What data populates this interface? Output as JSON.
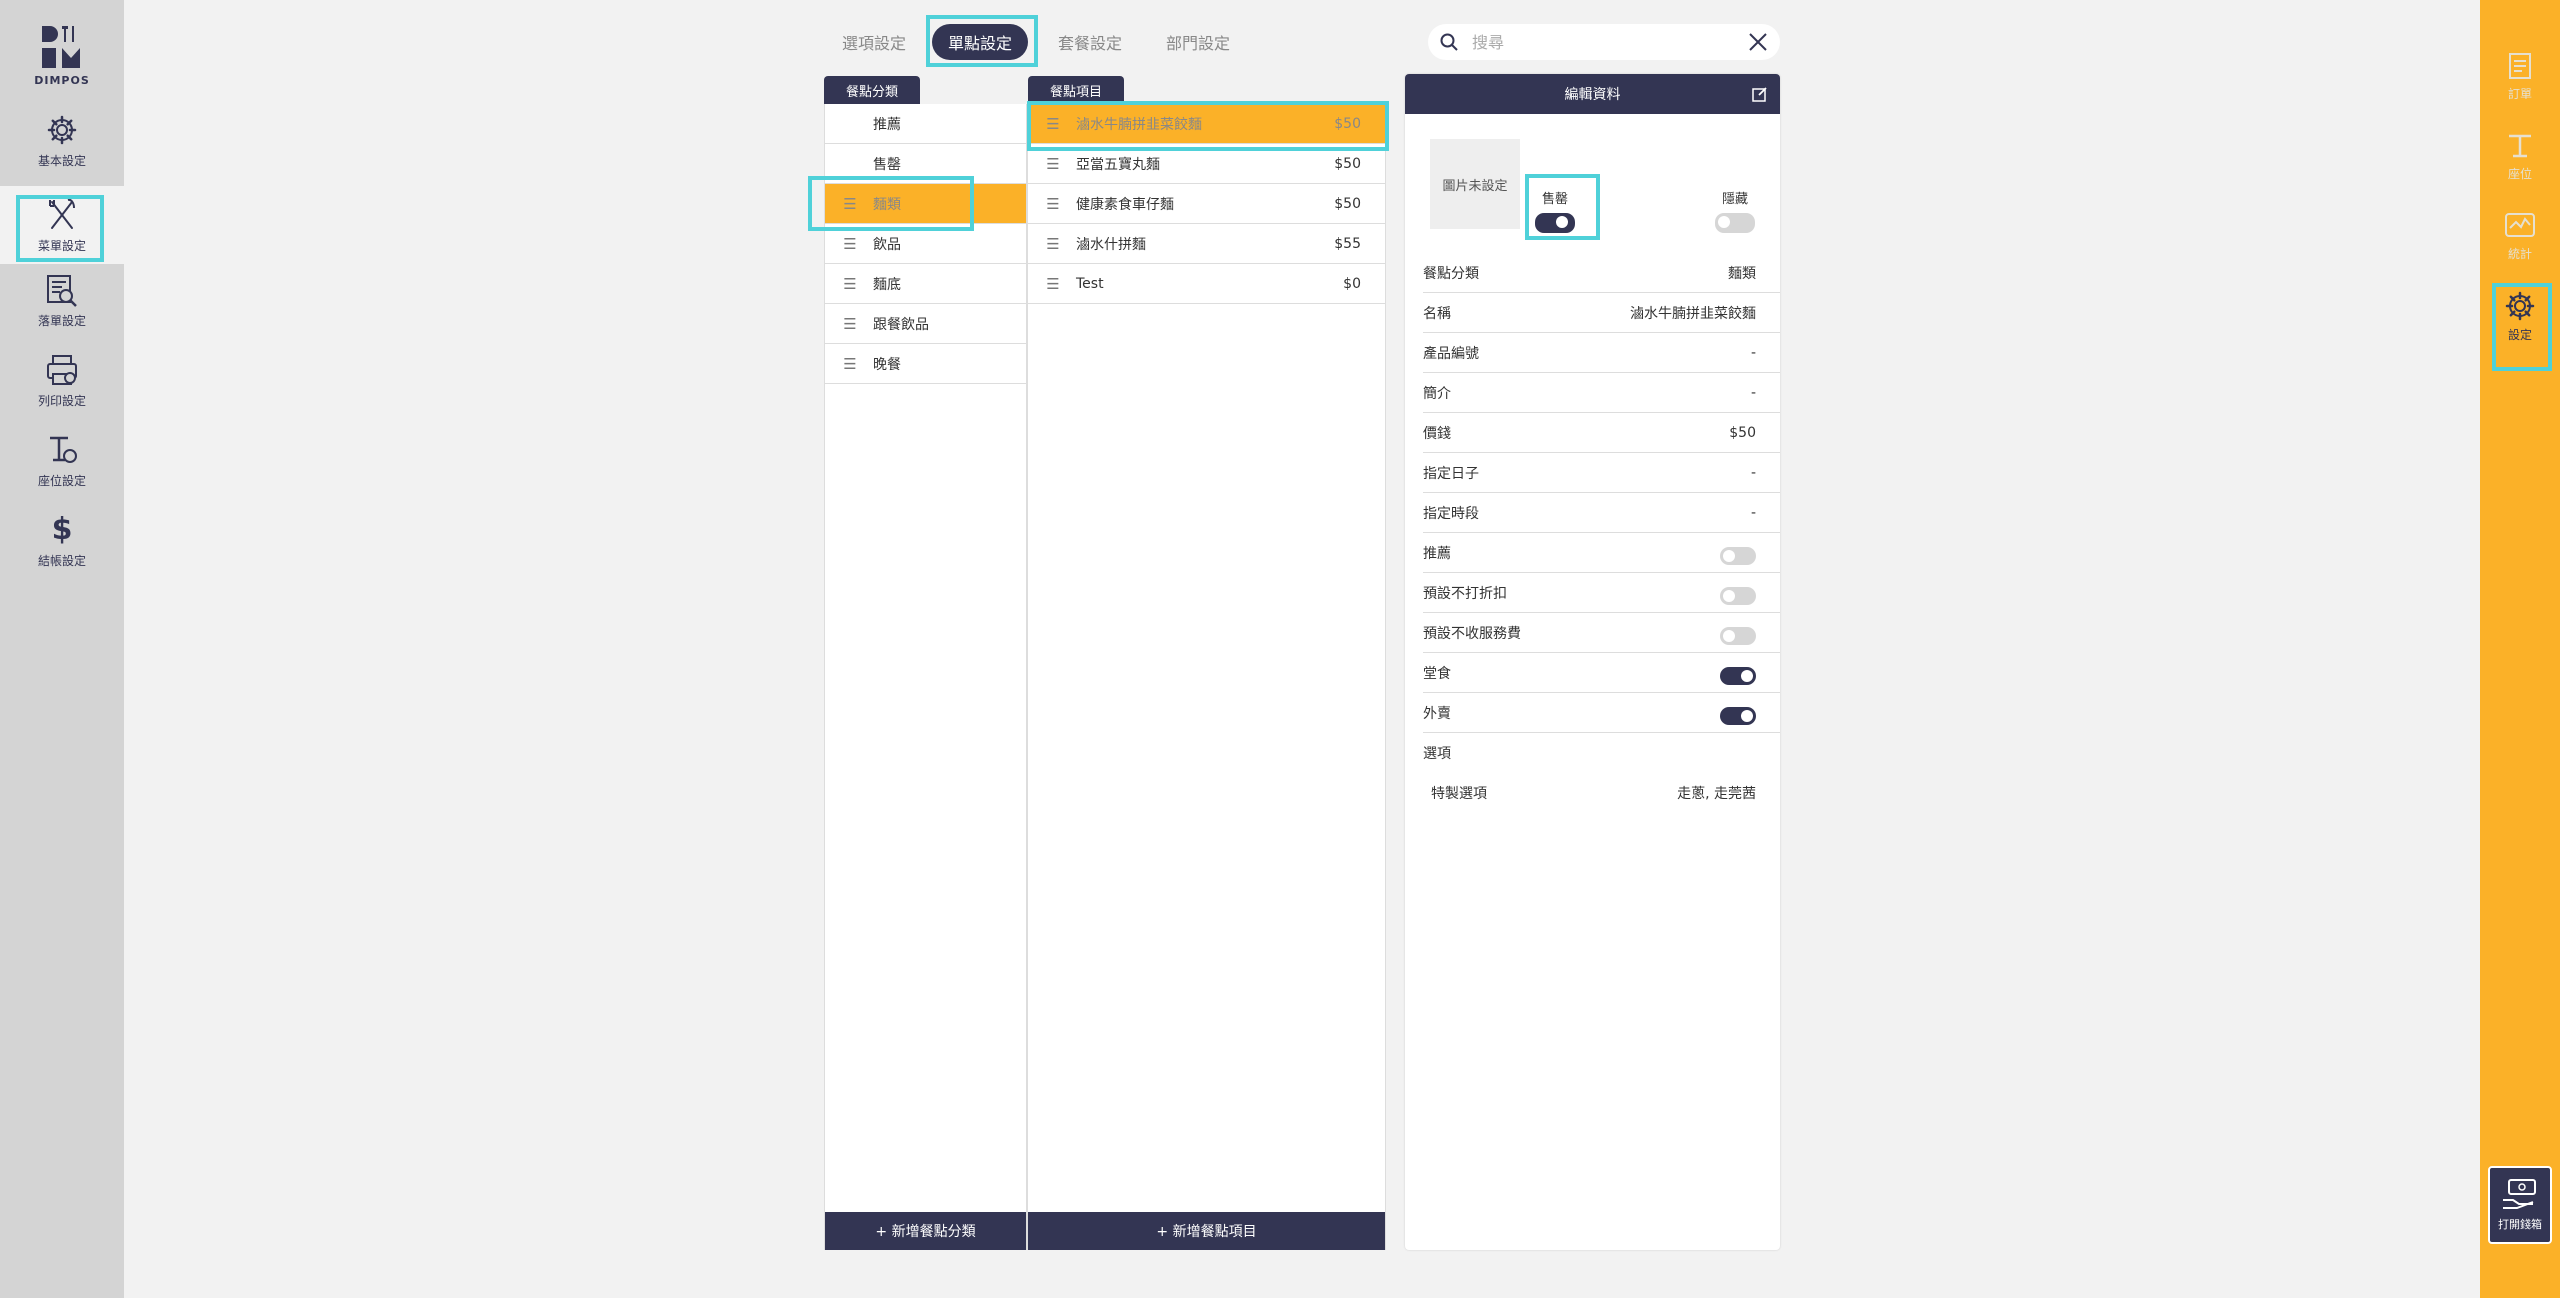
{
  "brand": {
    "logo_text": "DIMPOS"
  },
  "left_nav": [
    {
      "label": "基本設定",
      "icon": "gear-icon"
    },
    {
      "label": "菜單設定",
      "icon": "utensils-icon"
    },
    {
      "label": "落單設定",
      "icon": "order-search-icon"
    },
    {
      "label": "列印設定",
      "icon": "printer-icon"
    },
    {
      "label": "座位設定",
      "icon": "seat-icon"
    },
    {
      "label": "結帳設定",
      "icon": "dollar-icon"
    }
  ],
  "right_nav": [
    {
      "label": "訂單",
      "icon": "order-list-icon"
    },
    {
      "label": "座位",
      "icon": "table-icon"
    },
    {
      "label": "統計",
      "icon": "chart-icon"
    },
    {
      "label": "設定",
      "icon": "gear-icon"
    }
  ],
  "cashbox": {
    "label": "打開錢箱"
  },
  "tabs": [
    "選項設定",
    "單點設定",
    "套餐設定",
    "部門設定"
  ],
  "search": {
    "placeholder": "搜尋"
  },
  "categories": {
    "header": "餐點分類",
    "items": [
      "推薦",
      "售罄",
      "麵類",
      "飲品",
      "麵底",
      "跟餐飲品",
      "晚餐"
    ],
    "footer": "+ 新增餐點分類"
  },
  "items": {
    "header": "餐點項目",
    "rows": [
      {
        "name": "滷水牛腩拼韭菜餃麵",
        "price": "$50"
      },
      {
        "name": "亞當五寶丸麵",
        "price": "$50"
      },
      {
        "name": "健康素食車仔麵",
        "price": "$50"
      },
      {
        "name": "滷水什拼麵",
        "price": "$55"
      },
      {
        "name": "Test",
        "price": "$0"
      }
    ],
    "footer": "+ 新增餐點項目"
  },
  "detail": {
    "header": "編輯資料",
    "image_placeholder": "圖片未設定",
    "soldout_label": "售罄",
    "hidden_label": "隱藏",
    "fields": [
      {
        "label": "餐點分類",
        "value": "麵類"
      },
      {
        "label": "名稱",
        "value": "滷水牛腩拼韭菜餃麵"
      },
      {
        "label": "產品編號",
        "value": "-"
      },
      {
        "label": "簡介",
        "value": "-"
      },
      {
        "label": "價錢",
        "value": "$50"
      },
      {
        "label": "指定日子",
        "value": "-"
      },
      {
        "label": "指定時段",
        "value": "-"
      }
    ],
    "toggles": [
      {
        "label": "推薦",
        "on": false
      },
      {
        "label": "預設不打折扣",
        "on": false
      },
      {
        "label": "預設不收服務費",
        "on": false
      },
      {
        "label": "堂食",
        "on": true
      },
      {
        "label": "外賣",
        "on": true
      }
    ],
    "options_label": "選項",
    "option": {
      "label": "特製選項",
      "value": "走蔥, 走莞茜"
    }
  }
}
